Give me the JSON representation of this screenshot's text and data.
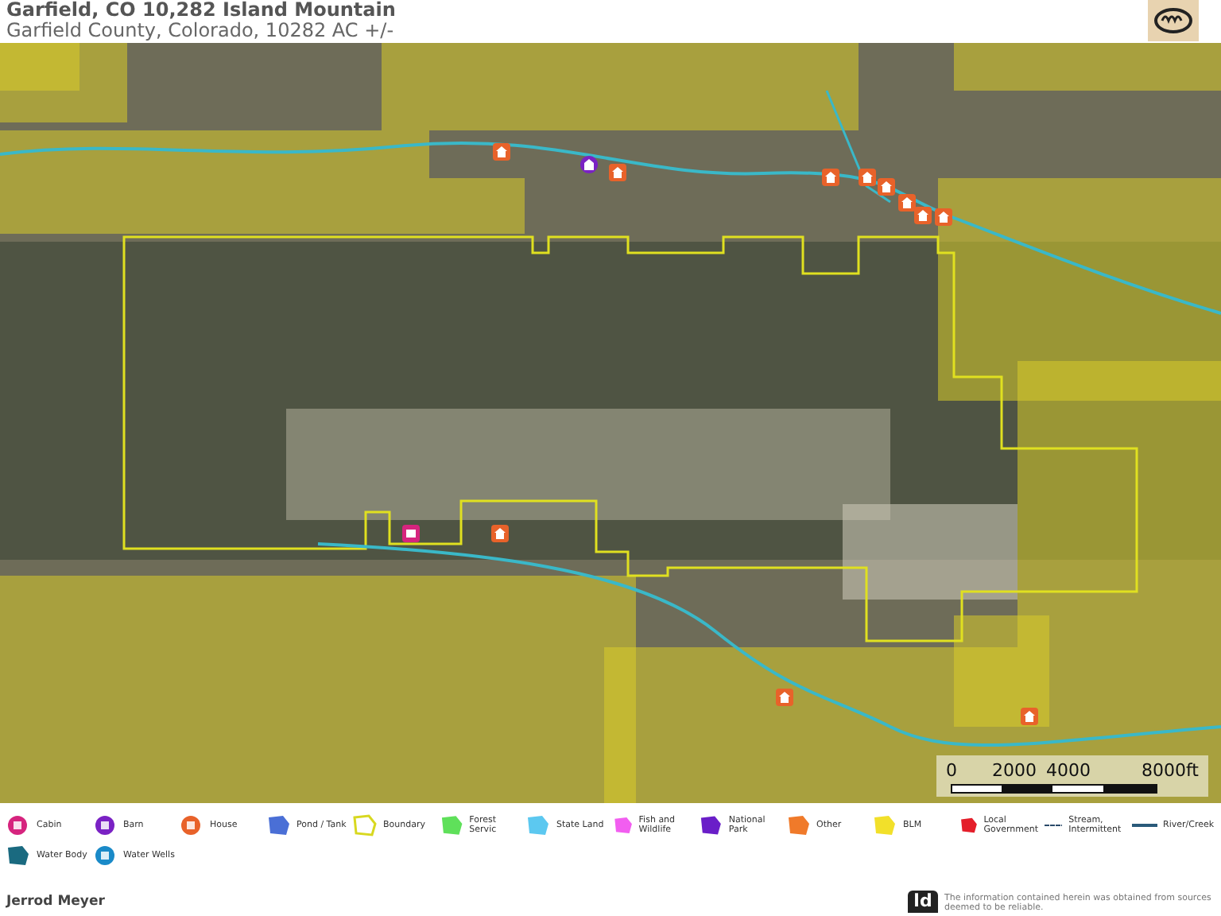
{
  "header": {
    "title": "Garfield, CO 10,282 Island Mountain",
    "subtitle": "Garfield County, Colorado, 10282 AC +/-"
  },
  "map": {
    "scale_bar": {
      "labels": [
        "0",
        "2000",
        "4000",
        "8000ft"
      ]
    }
  },
  "legend": [
    {
      "label": "Cabin",
      "kind": "marker",
      "color": "#d6247e"
    },
    {
      "label": "Barn",
      "kind": "marker",
      "color": "#7a22c4"
    },
    {
      "label": "House",
      "kind": "marker",
      "color": "#e8622a"
    },
    {
      "label": "Pond / Tank",
      "kind": "polygon",
      "color": "#4a6fd6"
    },
    {
      "label": "Boundary",
      "kind": "outline",
      "color": "#d8d820"
    },
    {
      "label": "Forest Servic",
      "kind": "polygon",
      "color": "#5fe05a"
    },
    {
      "label": "State Land",
      "kind": "polygon",
      "color": "#5cc8f0"
    },
    {
      "label": "Fish and Wildlife",
      "kind": "polygon",
      "color": "#f25ef0"
    },
    {
      "label": "National Park",
      "kind": "polygon",
      "color": "#6a1ec8"
    },
    {
      "label": "Other",
      "kind": "polygon",
      "color": "#f07a2a"
    },
    {
      "label": "BLM",
      "kind": "polygon",
      "color": "#f2e02a"
    },
    {
      "label": "Local Government",
      "kind": "polygon",
      "color": "#e41e2a"
    },
    {
      "label": "Stream, Intermittent",
      "kind": "dashed",
      "color": "#2a4a6a"
    },
    {
      "label": "River/Creek",
      "kind": "line",
      "color": "#2a5a7a"
    },
    {
      "label": "Water Body",
      "kind": "polygon",
      "color": "#1a6a80"
    },
    {
      "label": "Water Wells",
      "kind": "marker",
      "color": "#1a8ac8"
    }
  ],
  "footer": {
    "agent": "Jerrod Meyer",
    "logo_text": "ld",
    "disclaimer": "The information contained herein was obtained from sources deemed to be reliable."
  }
}
